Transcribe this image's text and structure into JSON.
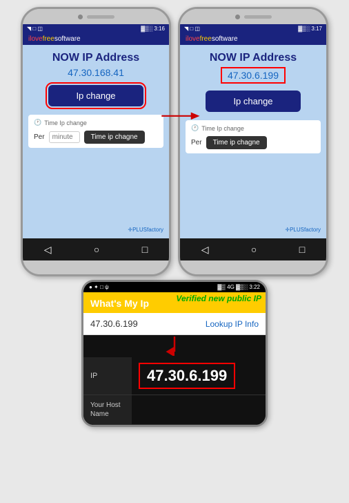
{
  "brand": "ilovefree",
  "brand_soft": "software",
  "phone_left": {
    "time": "3:16",
    "status_icons": "◥ □ ◫ ψ",
    "ip_label": "NOW IP Address",
    "ip_address": "47.30.168.41",
    "ip_change_btn": "Ip change",
    "time_ip_label": "Time Ip change",
    "per_label": "Per",
    "minute_placeholder": "minute",
    "time_change_btn": "Time ip chagne",
    "plus_factory": "✛PLUSfactory"
  },
  "phone_right": {
    "time": "3:17",
    "status_icons": "◥ □ ◫ ψ",
    "ip_label": "NOW IP Address",
    "ip_address": "47.30.6.199",
    "ip_change_btn": "Ip change",
    "time_ip_label": "Time Ip change",
    "per_label": "Per",
    "minute_placeholder": "",
    "time_change_btn": "Time ip chagne",
    "plus_factory": "✛PLUSfactory"
  },
  "phone_bottom": {
    "time": "3:22",
    "status_icons": "● ✦ □ ψ",
    "verified_text": "Verified new public IP",
    "whats_my_ip": "What's My Ip",
    "lookup_ip": "47.30.6.199",
    "lookup_btn": "Lookup IP Info",
    "table": {
      "ip_label": "IP",
      "ip_value": "47.30.6.199",
      "host_label": "Your Host Name",
      "host_value": ""
    }
  },
  "nav_back": "◁",
  "nav_home": "○",
  "nav_recent": "□",
  "icons": {
    "clock": "🕐",
    "plus_factory_icon": "✛"
  }
}
